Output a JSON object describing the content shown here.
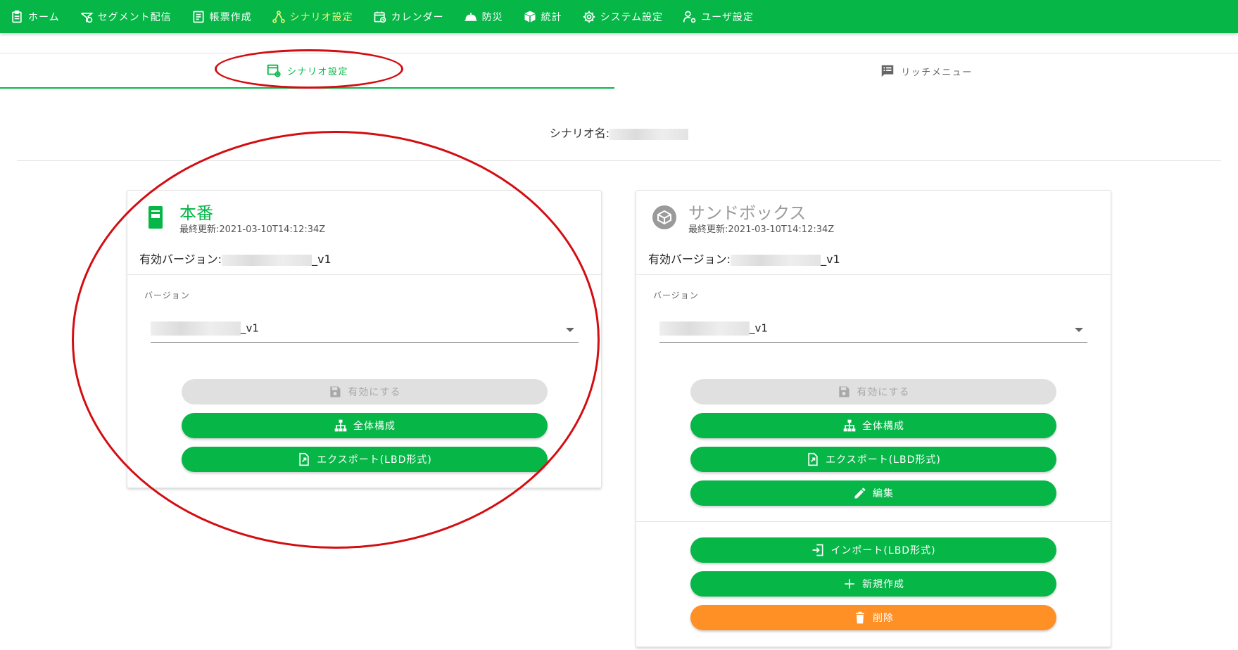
{
  "nav": {
    "items": [
      {
        "label": "ホーム",
        "icon": "clipboard-icon"
      },
      {
        "label": "セグメント配信",
        "icon": "segment-delivery-icon"
      },
      {
        "label": "帳票作成",
        "icon": "form-icon"
      },
      {
        "label": "シナリオ設定",
        "icon": "scenario-icon",
        "active": true
      },
      {
        "label": "カレンダー",
        "icon": "calendar-icon"
      },
      {
        "label": "防災",
        "icon": "disaster-icon"
      },
      {
        "label": "統計",
        "icon": "stats-icon"
      },
      {
        "label": "システム設定",
        "icon": "gear-icon"
      },
      {
        "label": "ユーザ設定",
        "icon": "user-settings-icon"
      }
    ]
  },
  "tabs": {
    "scenario": "シナリオ設定",
    "rich_menu": "リッチメニュー"
  },
  "scenario": {
    "name_label": "シナリオ名:"
  },
  "production": {
    "title": "本番",
    "updated": "最終更新:2021-03-10T14:12:34Z",
    "active_version_label": "有効バージョン:",
    "active_version_suffix": "_v1",
    "version_label": "バージョン",
    "version_value_suffix": "_v1",
    "buttons": {
      "activate": "有効にする",
      "overview": "全体構成",
      "export": "エクスポート(LBD形式)"
    }
  },
  "sandbox": {
    "title": "サンドボックス",
    "updated": "最終更新:2021-03-10T14:12:34Z",
    "active_version_label": "有効バージョン:",
    "active_version_suffix": "_v1",
    "version_label": "バージョン",
    "version_value_suffix": "_v1",
    "buttons": {
      "activate": "有効にする",
      "overview": "全体構成",
      "export": "エクスポート(LBD形式)",
      "edit": "編集",
      "import": "インポート(LBD形式)",
      "create": "新規作成",
      "delete": "削除"
    }
  },
  "colors": {
    "brand_green": "#06b748",
    "active_nav": "#f2f27a",
    "danger_orange": "#ff9026",
    "annotation_red": "#d30d12"
  }
}
